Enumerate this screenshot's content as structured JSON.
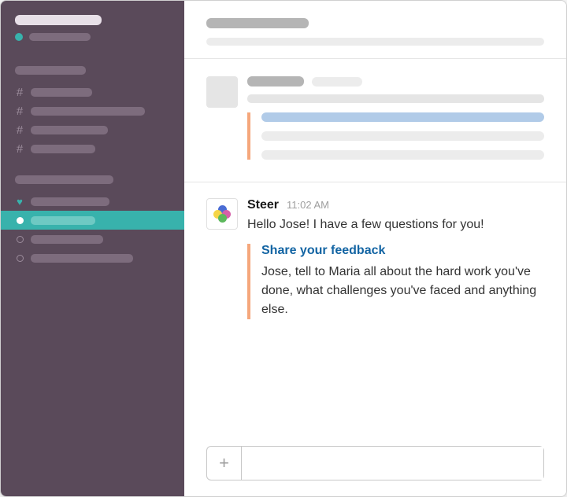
{
  "sidebar": {
    "channels_prefix": "#",
    "heart_prefix": "♥"
  },
  "steer_message": {
    "sender": "Steer",
    "time": "11:02 AM",
    "text": "Hello Jose! I have a few questions for you!",
    "attachment": {
      "title": "Share your feedback",
      "body": "Jose, tell to Maria all about the hard work you've done, what challenges you've faced and anything else."
    }
  },
  "compose": {
    "placeholder": ""
  }
}
